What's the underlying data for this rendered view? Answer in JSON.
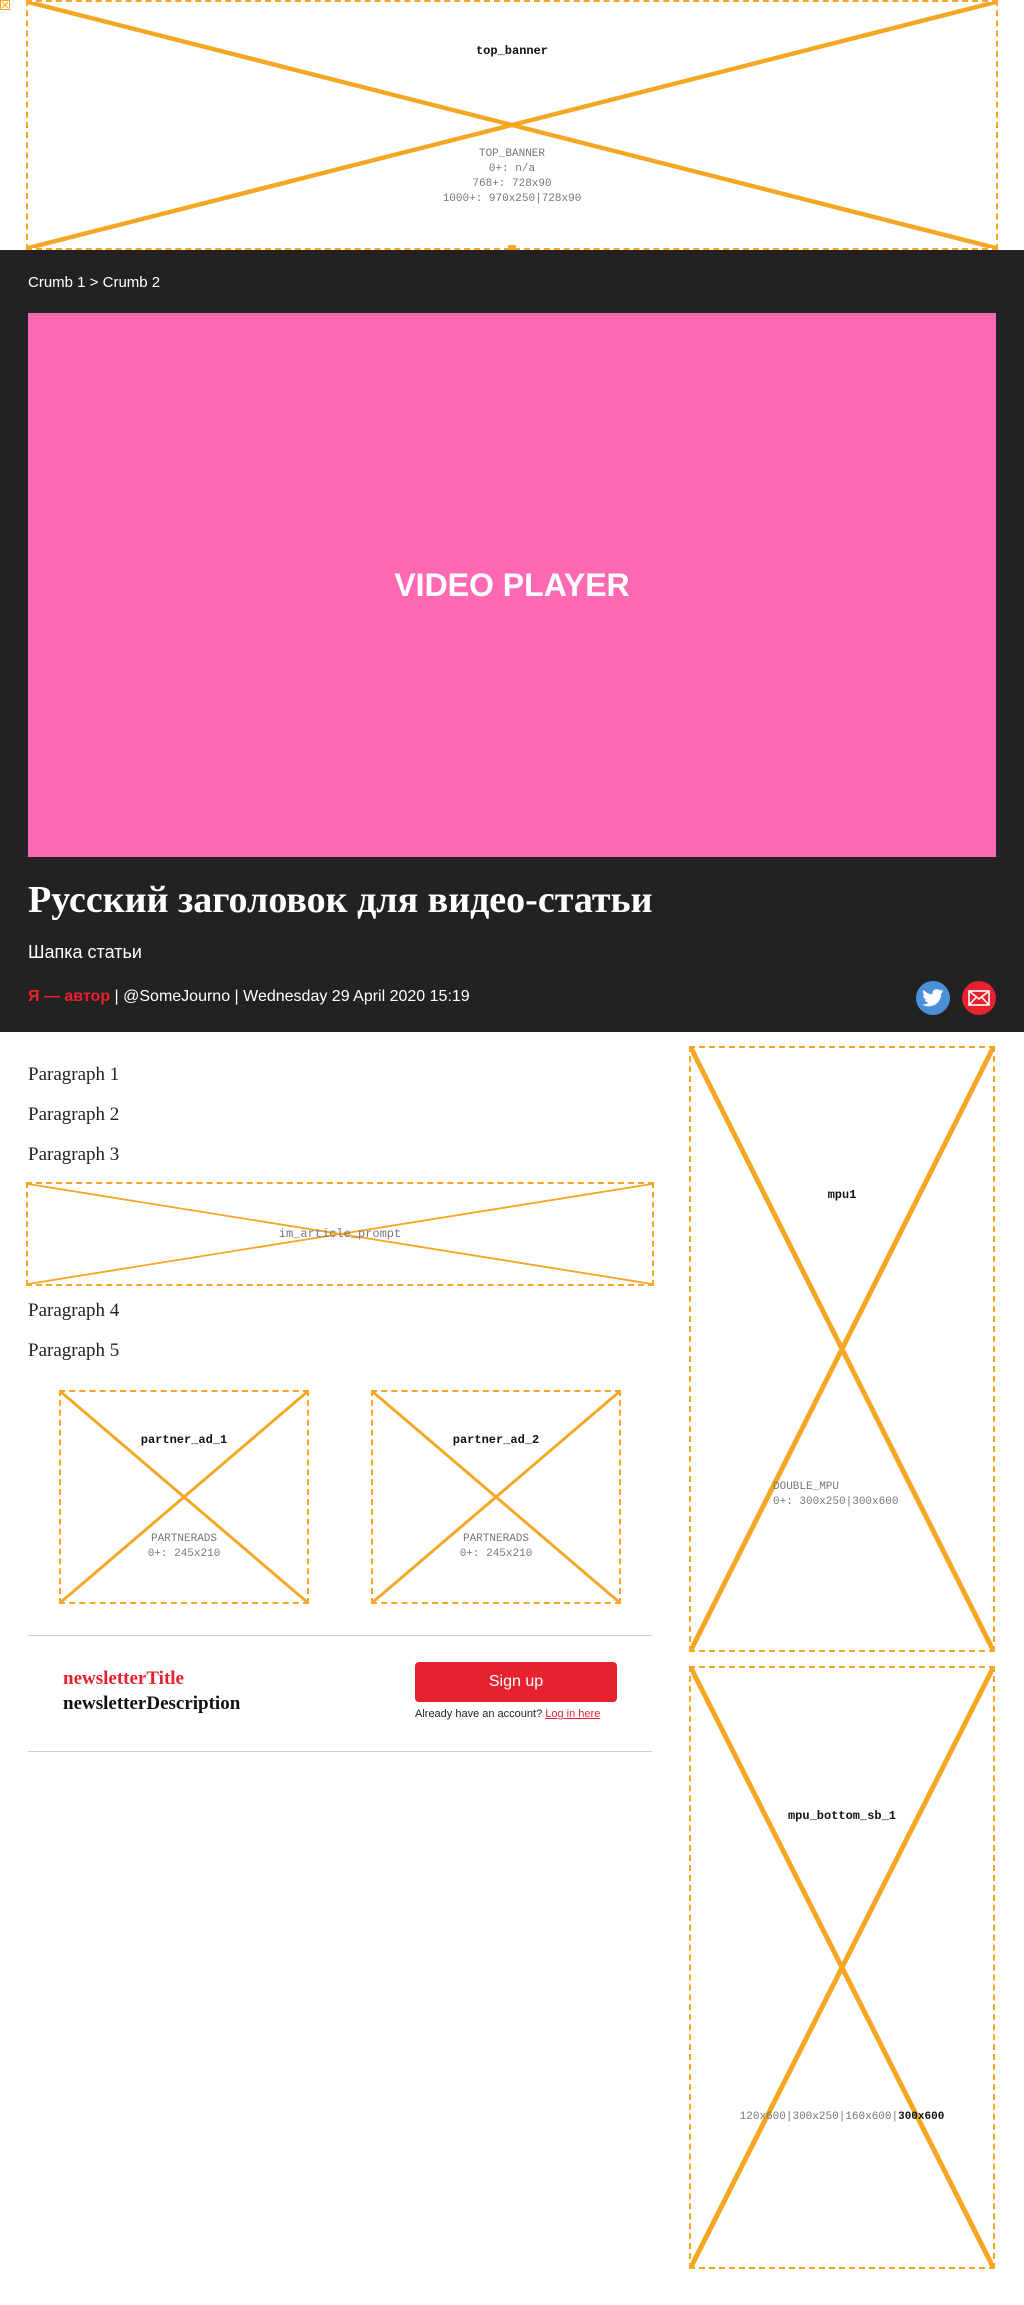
{
  "ads": {
    "top_banner": {
      "name": "top_banner",
      "meta": [
        "TOP_BANNER",
        "0+: n/a",
        "768+: 728x90",
        "1000+: 970x250|728x90"
      ]
    },
    "in_article_prompt": {
      "name": "im_article_prompt"
    },
    "partner_ad_1": {
      "name": "partner_ad_1",
      "meta": [
        "PARTNERADS",
        "0+: 245x210"
      ]
    },
    "partner_ad_2": {
      "name": "partner_ad_2",
      "meta": [
        "PARTNERADS",
        "0+: 245x210"
      ]
    },
    "mpu1": {
      "name": "mpu1",
      "meta": [
        "DOUBLE_MPU",
        "0+: 300x250|300x600"
      ]
    },
    "mpu_bottom_sb_1": {
      "name": "mpu_bottom_sb_1",
      "meta_prefix": "120x600|300x250|160x600|",
      "meta_bold": "300x600"
    }
  },
  "breadcrumb": "Crumb 1 > Crumb 2",
  "video": {
    "label": "VIDEO PLAYER",
    "color": "#ff69b4"
  },
  "article": {
    "title": "Русский заголовок для видео-статьи",
    "standfirst": "Шапка статьи",
    "author": "Я — автор",
    "byline_rest": " | @SomeJourno | Wednesday 29 April 2020 15:19",
    "paragraphs": [
      "Paragraph 1",
      "Paragraph 2",
      "Paragraph 3",
      "Paragraph 4",
      "Paragraph 5"
    ]
  },
  "share": {
    "icons": [
      "twitter-icon",
      "email-icon"
    ]
  },
  "newsletter": {
    "title": "newsletterTitle",
    "description": "newsletterDescription",
    "signup_label": "Sign up",
    "account_prompt": "Already have an account?",
    "login_label": "Log in here"
  },
  "colors": {
    "accent": "#e8212f",
    "hero_bg": "#222222",
    "ad_outline": "#f5a623",
    "twitter": "#4a90d9"
  }
}
